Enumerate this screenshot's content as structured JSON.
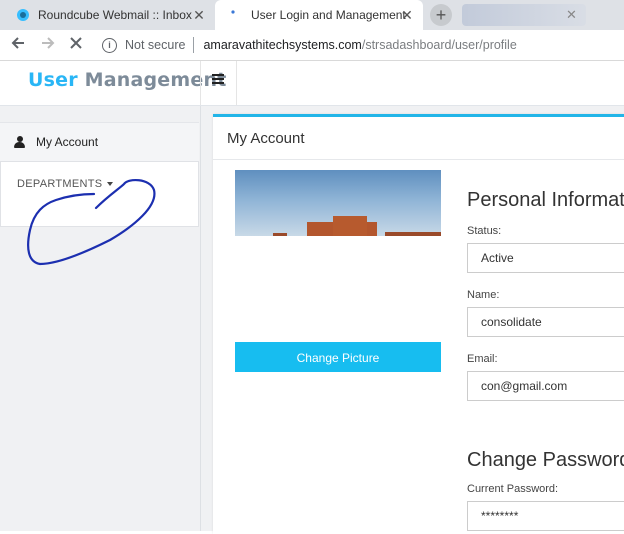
{
  "browser": {
    "tabs": [
      {
        "title": "Roundcube Webmail :: Inbox",
        "active": false
      },
      {
        "title": "User Login and Management",
        "active": true
      }
    ],
    "new_tab_label": "+",
    "security_text": "Not secure",
    "url_host": "amaravathitechsystems.com",
    "url_path": "/strsadashboard/user/profile"
  },
  "header": {
    "logo_part1": "User",
    "logo_part2": "Management",
    "menu_icon": "hamburger-icon",
    "colors": {
      "logo_accent": "#29b6f6",
      "logo_secondary": "#7d8b99",
      "card_accent": "#22b5e8",
      "button": "#17bdf0"
    }
  },
  "sidebar": {
    "items": [
      {
        "label": "My Account",
        "icon": "user-icon"
      }
    ],
    "departments_label": "DEPARTMENTS"
  },
  "main": {
    "card_title": "My Account",
    "change_picture_label": "Change Picture",
    "personal_info_title": "Personal Informat",
    "fields": {
      "status_label": "Status:",
      "status_value": "Active",
      "name_label": "Name:",
      "name_value": "consolidate",
      "email_label": "Email:",
      "email_value": "con@gmail.com"
    },
    "change_password_title": "Change Password:",
    "current_password_label": "Current Password:",
    "current_password_value": "********"
  }
}
